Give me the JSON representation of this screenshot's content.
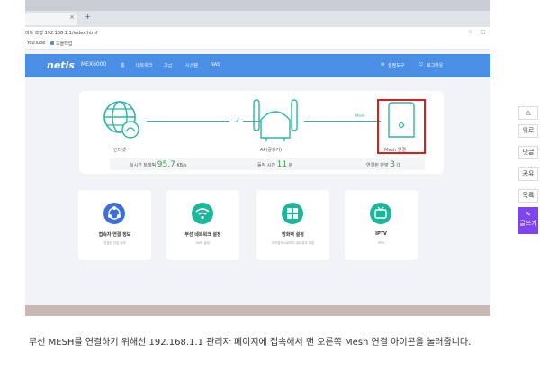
{
  "browser": {
    "tab_close": "×",
    "new_tab": "+",
    "address": "미도 조형  192.168.1.1/index.html",
    "bookmarks": [
      "YouTube",
      "초을티업"
    ]
  },
  "router_ui": {
    "brand": "netis",
    "model": "MEX6000",
    "nav_items": [
      "홈",
      "네트워크",
      "고급",
      "시스템",
      "NAS"
    ],
    "nav_right": [
      "설정도구",
      "로그아웃"
    ]
  },
  "network_card": {
    "internet_label": "인터넷",
    "ap_label": "AP(공유기)",
    "mesh_line_label": "Mesh",
    "mesh_label": "Mesh 연결",
    "stats": {
      "traffic_label": "실시간 트래픽",
      "traffic_value": "95.7",
      "traffic_unit": "KB/s",
      "uptime_label": "동작 시간",
      "uptime_value": "11",
      "uptime_unit": "분",
      "devices_label": "연결된 단말",
      "devices_value": "3",
      "devices_unit": "대"
    },
    "colors": {
      "line": "#2bb6a5",
      "highlight": "#e01b1b",
      "stat_value": "#3c9a47"
    }
  },
  "features": [
    {
      "title": "접속자 연결 정보",
      "sub": "연결된 단말 정보",
      "icon": "users-network-icon",
      "color": "#3f6fd9"
    },
    {
      "title": "무선 네트워크 설정",
      "sub": "WiFi 설정",
      "icon": "wifi-icon",
      "color": "#1bb79a"
    },
    {
      "title": "방화벽 설정",
      "sub": "외부접속으로부터 네트워크 보호",
      "icon": "firewall-icon",
      "color": "#1bb79a"
    },
    {
      "title": "IPTV",
      "sub": "IPTV",
      "icon": "tv-icon",
      "color": "#1bb79a"
    }
  ],
  "blog_sidebar": {
    "items": [
      "위로",
      "댓글",
      "공유",
      "목록"
    ],
    "write_label": "글쓰기"
  },
  "caption": "무선 MESH를 연결하기 위해선 192.168.1.1 관리자 페이지에 접속해서 맨 오른쪽 Mesh 연결 아이콘을 눌러줍니다."
}
